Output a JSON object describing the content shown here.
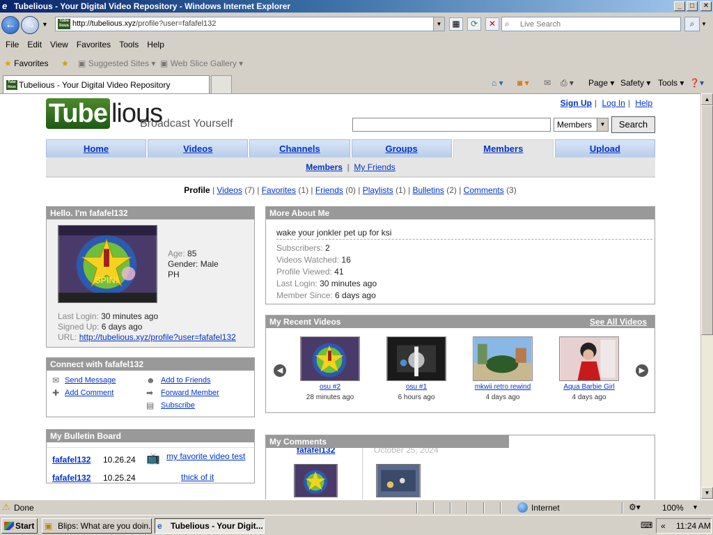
{
  "window": {
    "title": "Tubelious - Your Digital Video Repository - Windows Internet Explorer"
  },
  "address": {
    "url_host": "http://tubelious.xyz",
    "url_path": "/profile?user=fafafel132",
    "live_search_placeholder": "Live Search"
  },
  "menu": [
    "File",
    "Edit",
    "View",
    "Favorites",
    "Tools",
    "Help"
  ],
  "favorites_bar": {
    "favorites": "Favorites",
    "suggested": "Suggested Sites ▾",
    "webslice": "Web Slice Gallery ▾"
  },
  "tab": {
    "title": "Tubelious - Your Digital Video Repository"
  },
  "command_bar": {
    "page": "Page ▾",
    "safety": "Safety ▾",
    "tools": "Tools ▾"
  },
  "site": {
    "logo_tube": "Tube",
    "logo_rest": "lious",
    "tagline": "Broadcast Yourself",
    "toplinks": {
      "signup": "Sign Up",
      "login": "Log In",
      "help": "Help",
      "sep": "|"
    },
    "search": {
      "value": "",
      "scope": "Members",
      "button": "Search"
    },
    "nav": [
      "Home",
      "Videos",
      "Channels",
      "Groups",
      "Members",
      "Upload"
    ],
    "subnav": {
      "members": "Members",
      "friends": "My Friends",
      "sep": "|"
    }
  },
  "profile_tabs": {
    "profile": "Profile",
    "videos": "Videos",
    "videos_count": "(7)",
    "favorites": "Favorites",
    "favorites_count": "(1)",
    "friends": "Friends",
    "friends_count": "(0)",
    "playlists": "Playlists",
    "playlists_count": "(1)",
    "bulletins": "Bulletins",
    "bulletins_count": "(2)",
    "comments": "Comments",
    "comments_count": "(3)"
  },
  "hello": {
    "header": "Hello. I'm fafafel132",
    "age_label": "Age:",
    "age": "85",
    "gender": "Gender: Male",
    "country": "PH",
    "last_login_label": "Last Login:",
    "last_login": "30 minutes ago",
    "signed_up_label": "Signed Up:",
    "signed_up": "6 days ago",
    "url_label": "URL:",
    "url": "http://tubelious.xyz/profile?user=fafafel132"
  },
  "connect": {
    "header": "Connect with fafafel132",
    "send_message": "Send Message",
    "add_comment": "Add Comment",
    "add_friends": "Add to Friends",
    "forward": "Forward Member",
    "subscribe": "Subscribe"
  },
  "bulletin": {
    "header": "My Bulletin Board",
    "rows": [
      {
        "user": "fafafel132",
        "date": "10.26.24",
        "title": "my favorite video test"
      },
      {
        "user": "fafafel132",
        "date": "10.25.24",
        "title": "thick of it"
      }
    ]
  },
  "about": {
    "header": "More About Me",
    "status": "wake your jonkler pet up for ksi",
    "subscribers_label": "Subscribers:",
    "subscribers": "2",
    "watched_label": "Videos Watched:",
    "watched": "16",
    "viewed_label": "Profile Viewed:",
    "viewed": "41",
    "last_login_label": "Last Login:",
    "last_login": "30 minutes ago",
    "since_label": "Member Since:",
    "since": "6 days ago"
  },
  "recent": {
    "header": "My Recent Videos",
    "see_all": "See All Videos",
    "videos": [
      {
        "title": "osu #2",
        "when": "28 minutes ago"
      },
      {
        "title": "osu #1",
        "when": "6 hours ago"
      },
      {
        "title": "mkwii retro rewind",
        "when": "4 days ago"
      },
      {
        "title": "Aqua Barbie Girl",
        "when": "4 days ago"
      }
    ]
  },
  "comments": {
    "header": "My Comments",
    "user": "fafafel132",
    "date": "October 25, 2024"
  },
  "status": {
    "done": "Done",
    "zone": "Internet",
    "zoom": "100%"
  },
  "taskbar": {
    "start": "Start",
    "item1": "Blips: What are you doin...",
    "item2": "Tubelious - Your Digit...",
    "time": "11:24 AM"
  }
}
